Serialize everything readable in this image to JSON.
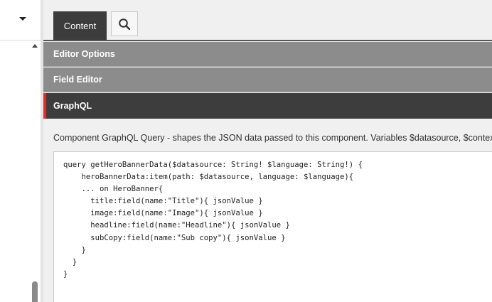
{
  "tabs": [
    {
      "label": "Content"
    },
    {
      "label": "",
      "icon": "search-icon"
    }
  ],
  "sections": {
    "editor_options": "Editor Options",
    "field_editor": "Field Editor",
    "graphql": "GraphQL"
  },
  "graphql": {
    "description": "Component GraphQL Query - shapes the JSON data passed to this component. Variables $datasource, $context",
    "query": "query getHeroBannerData($datasource: String! $language: String!) {\n    heroBannerData:item(path: $datasource, language: $language){\n    ... on HeroBanner{\n      title:field(name:\"Title\"){ jsonValue }\n      image:field(name:\"Image\"){ jsonValue }\n      headline:field(name:\"Headline\"){ jsonValue }\n      subCopy:field(name:\"Sub copy\"){ jsonValue }\n    }\n  }\n}"
  },
  "colors": {
    "active_tab": "#3c3c3c",
    "section_header": "#8c8c8c",
    "active_section": "#3d3d3d",
    "accent": "#d9302c"
  },
  "icons": [
    "chevron-down-icon",
    "scroll-up-arrow-icon",
    "search-icon"
  ]
}
